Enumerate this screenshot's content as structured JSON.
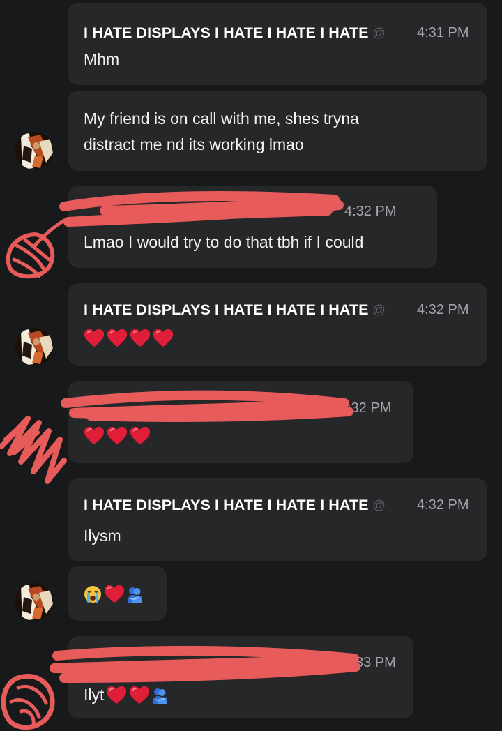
{
  "messages": [
    {
      "author": "I HATE DISPLAYS I HATE I HATE I HATE",
      "handle": "@",
      "time": "4:31 PM",
      "text": "Mhm"
    },
    {
      "text_line1": "My friend is on call with me, shes tryna",
      "text_line2": "distract me nd its working lmao"
    },
    {
      "time": "4:32 PM",
      "text": "Lmao I would try to do that tbh if I could"
    },
    {
      "author": "I HATE DISPLAYS I HATE I HATE I HATE",
      "handle": "@",
      "time": "4:32 PM",
      "emoji": [
        "red-heart",
        "red-heart",
        "red-heart",
        "red-heart"
      ]
    },
    {
      "time": ":32 PM",
      "emoji": [
        "red-heart",
        "red-heart",
        "red-heart"
      ]
    },
    {
      "author": "I HATE DISPLAYS I HATE I HATE I HATE",
      "handle": "@",
      "time": "4:32 PM",
      "text": "Ilysm"
    },
    {
      "emoji": [
        "loudly-crying-face",
        "red-heart",
        "people-hugging"
      ]
    },
    {
      "time": "33 PM",
      "text": "Ilyt",
      "emoji": [
        "red-heart",
        "red-heart",
        "people-hugging"
      ]
    }
  ],
  "colors": {
    "background": "#18191b",
    "bubble": "#262729",
    "timestamp": "#a4a5aa",
    "redaction": "#e85b5b",
    "heart": "#e01e37"
  }
}
